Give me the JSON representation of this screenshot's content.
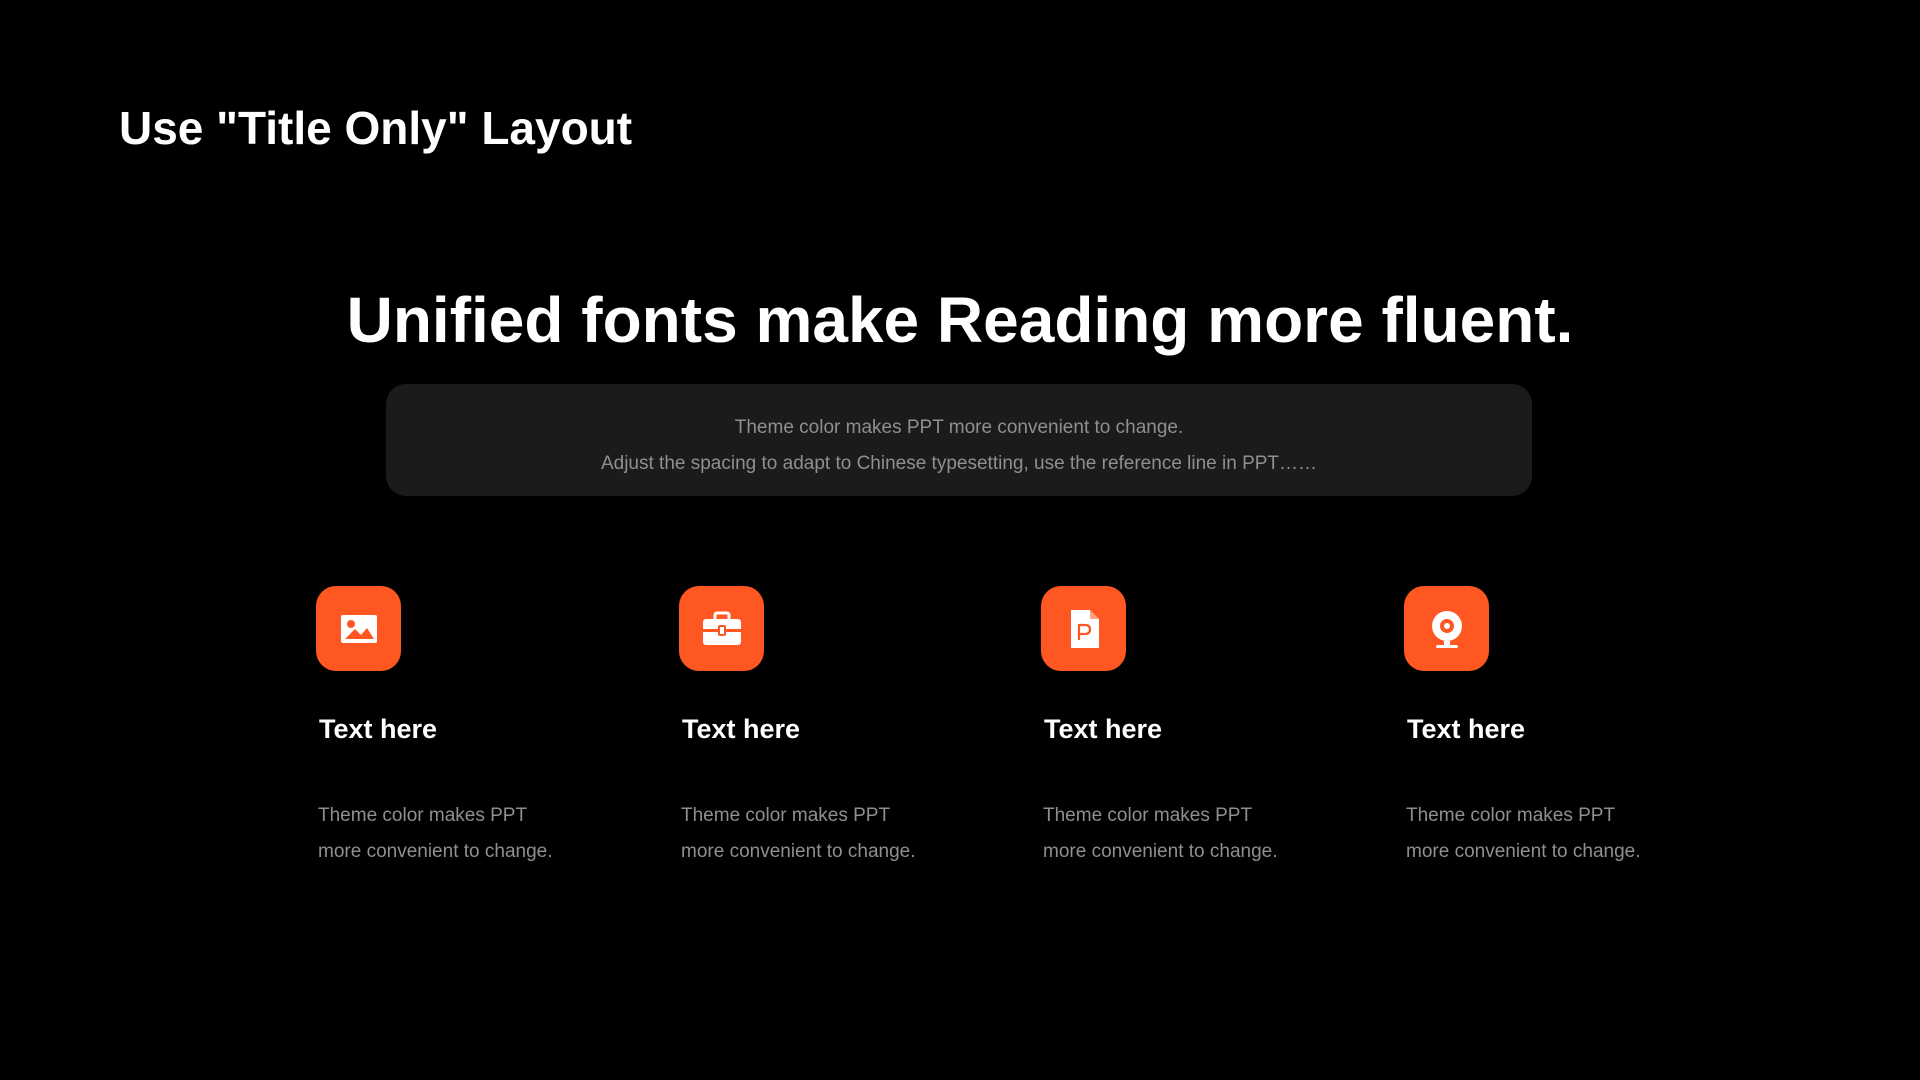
{
  "slide": {
    "title": "Use \"Title Only\" Layout",
    "headline": "Unified fonts make Reading more fluent.",
    "subtitle_lines": [
      "Theme color makes PPT more convenient to change.",
      "Adjust the spacing to adapt to Chinese typesetting, use the reference line in PPT……"
    ]
  },
  "features": [
    {
      "icon": "image-icon",
      "title": "Text here",
      "desc_lines": [
        "Theme color makes PPT",
        "more convenient to change."
      ]
    },
    {
      "icon": "briefcase-icon",
      "title": "Text here",
      "desc_lines": [
        "Theme color makes PPT",
        "more convenient to change."
      ]
    },
    {
      "icon": "ppt-file-icon",
      "title": "Text here",
      "desc_lines": [
        "Theme color makes PPT",
        "more convenient to change."
      ]
    },
    {
      "icon": "webcam-icon",
      "title": "Text here",
      "desc_lines": [
        "Theme color makes PPT",
        "more convenient to change."
      ]
    }
  ],
  "colors": {
    "background": "#000000",
    "accent": "#fe5722",
    "muted_text": "#8f8f8f",
    "box_background": "#1b1b1b"
  }
}
